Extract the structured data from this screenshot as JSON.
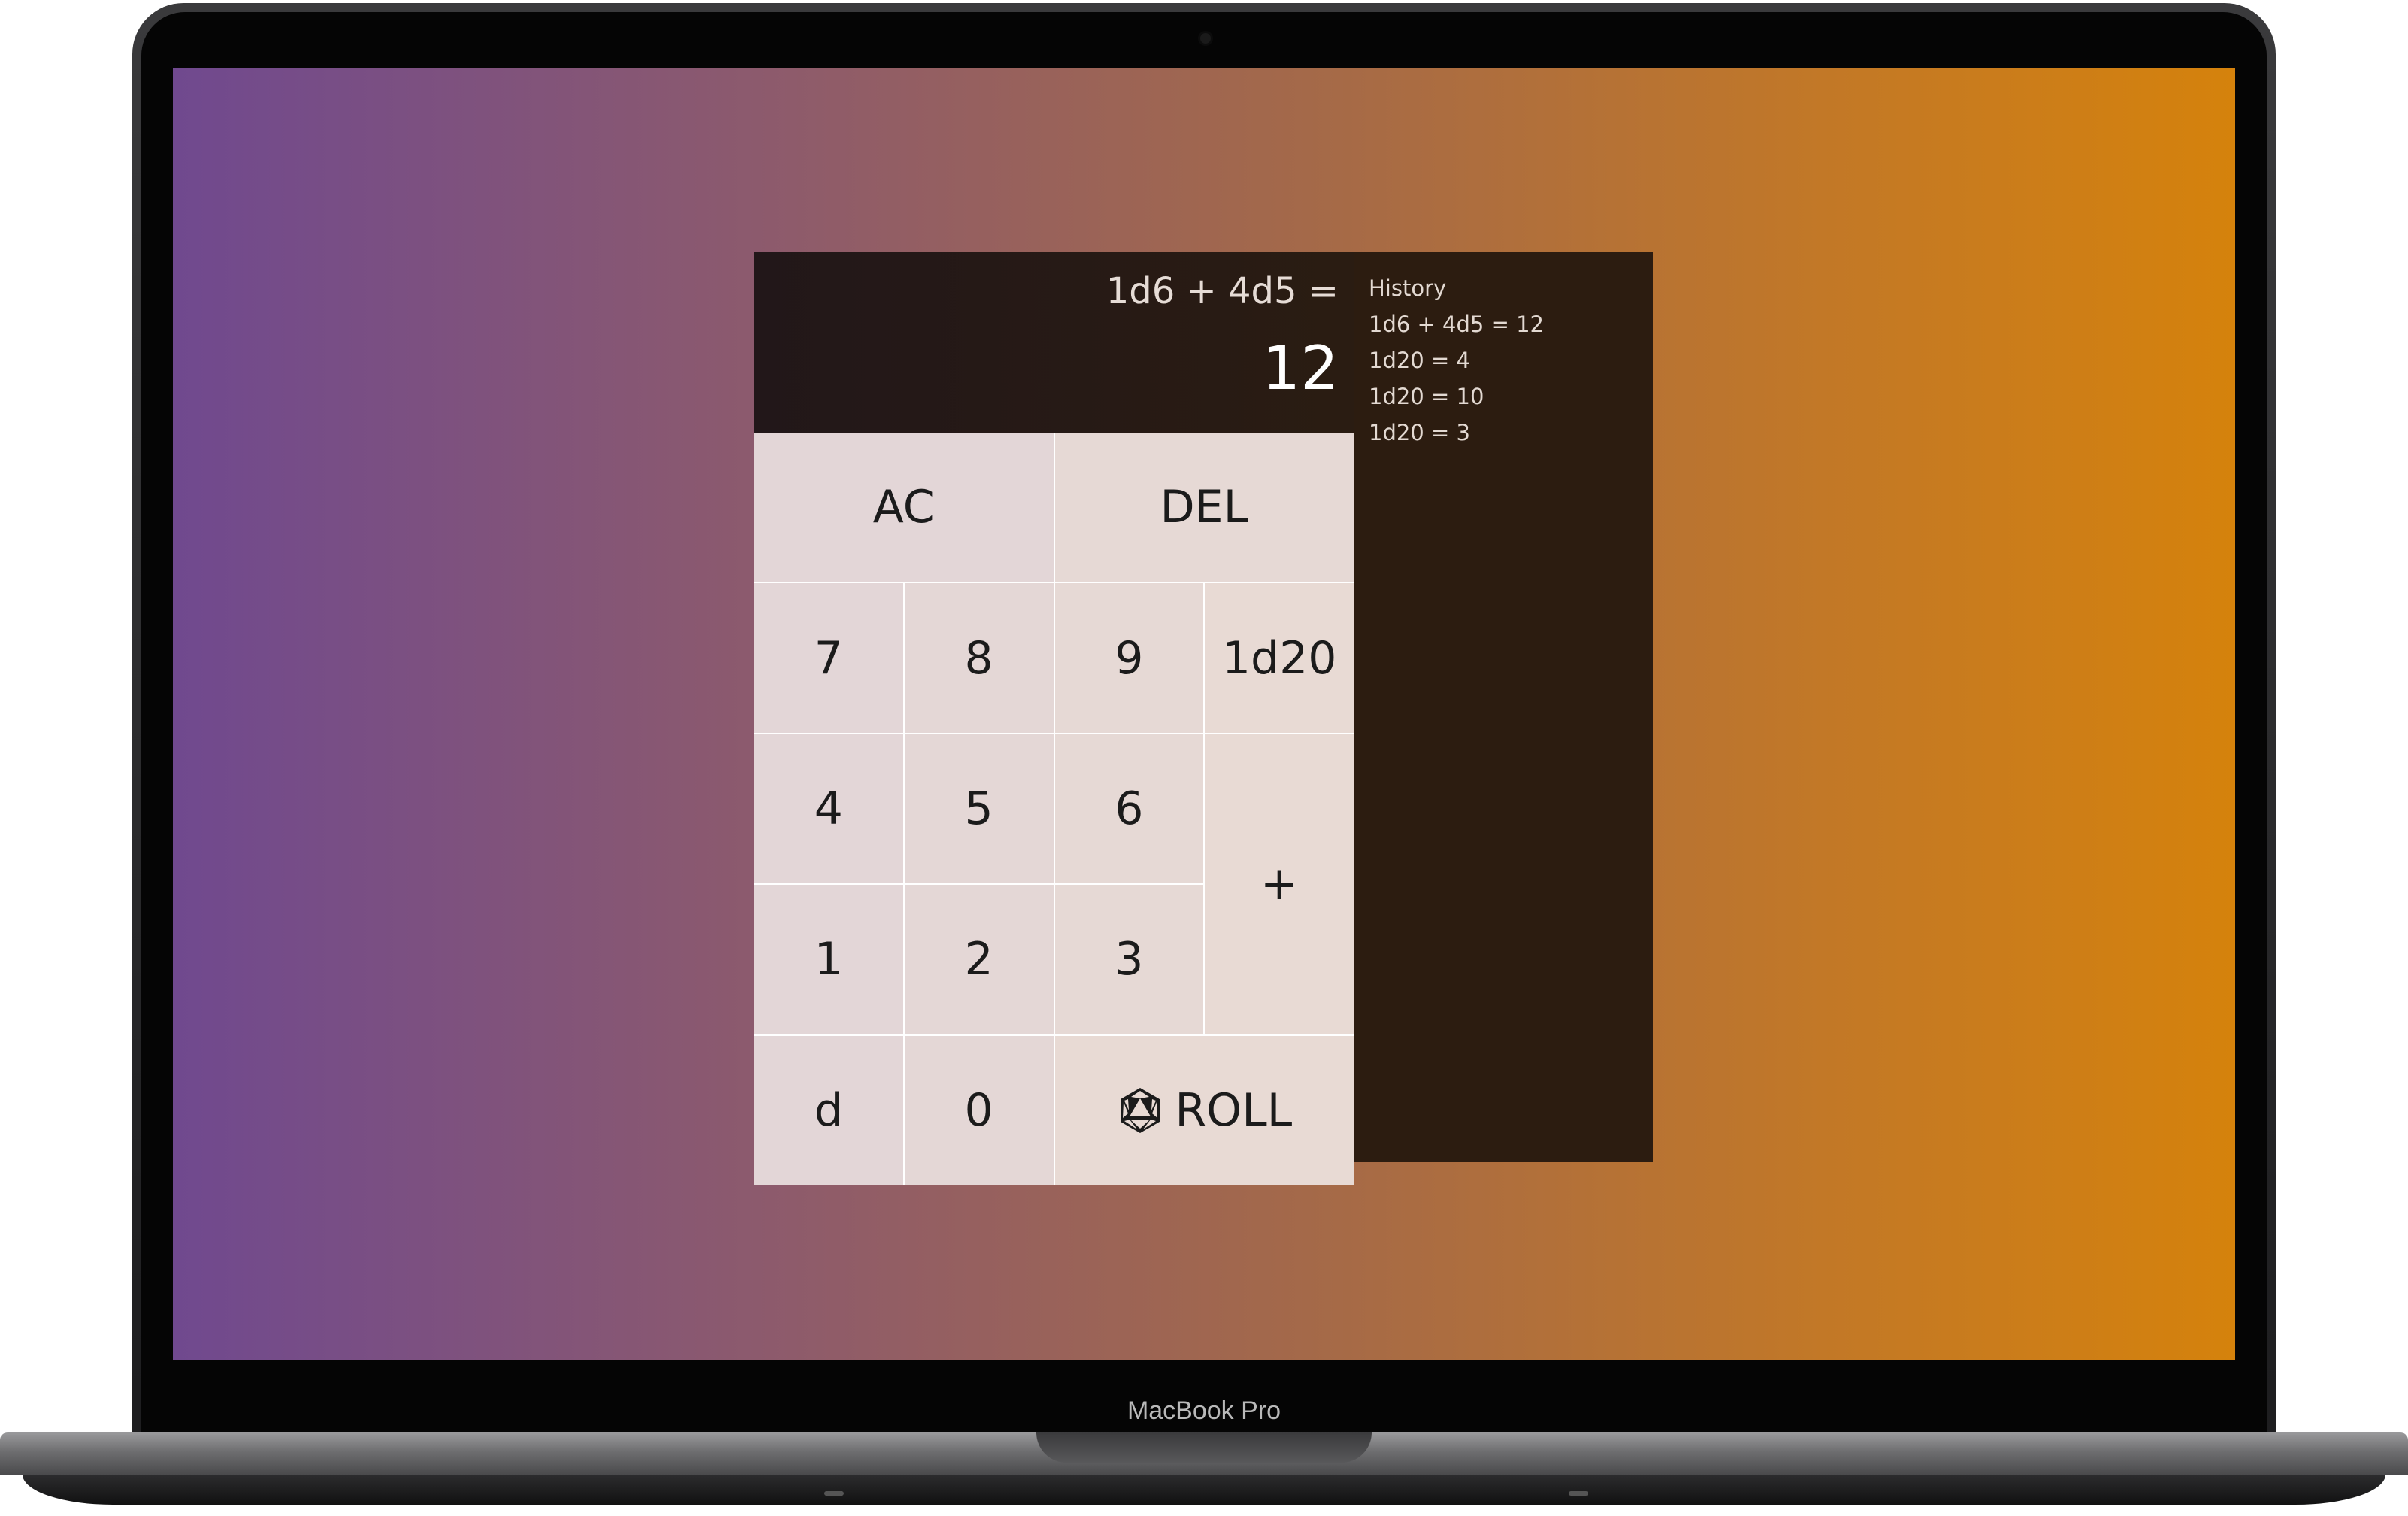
{
  "device": {
    "label": "MacBook Pro"
  },
  "calculator": {
    "expression": "1d6 + 4d5 =",
    "result": "12",
    "keys": {
      "ac": "AC",
      "del": "DEL",
      "seven": "7",
      "eight": "8",
      "nine": "9",
      "d20": "1d20",
      "four": "4",
      "five": "5",
      "six": "6",
      "plus": "+",
      "one": "1",
      "two": "2",
      "three": "3",
      "d": "d",
      "zero": "0",
      "roll": "ROLL",
      "roll_icon": "d20-icon"
    }
  },
  "history": {
    "title": "History",
    "items": [
      "1d6 + 4d5 = 12",
      "1d20 = 4",
      "1d20 = 10",
      "1d20 = 3"
    ]
  },
  "colors": {
    "background_gradient": [
      "#70498f",
      "#d5820c"
    ],
    "display_bg": "#221719",
    "history_bg": "#2c1c10",
    "key_bg": "#e5d8d6"
  }
}
